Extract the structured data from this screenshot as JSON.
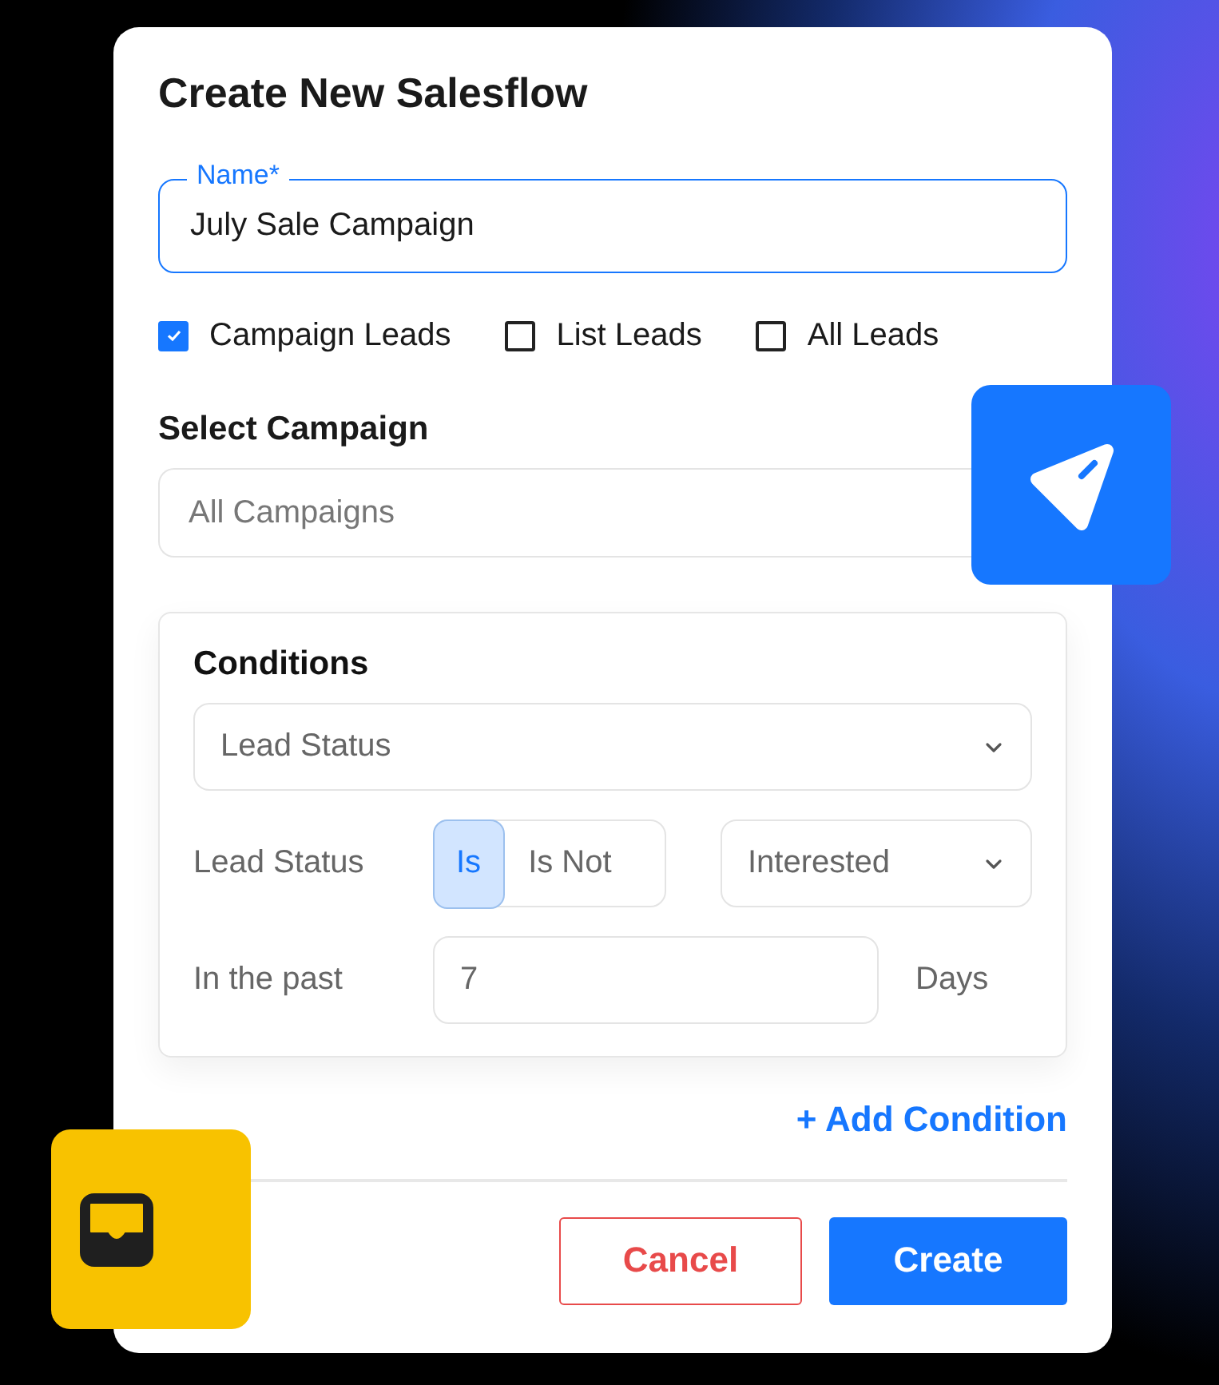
{
  "dialog": {
    "title": "Create New Salesflow",
    "name_field": {
      "label": "Name*",
      "value": "July Sale Campaign"
    },
    "lead_sources": [
      {
        "label": "Campaign Leads",
        "checked": true
      },
      {
        "label": "List Leads",
        "checked": false
      },
      {
        "label": "All Leads",
        "checked": false
      }
    ],
    "campaign": {
      "label": "Select Campaign",
      "placeholder": "All Campaigns"
    },
    "conditions": {
      "title": "Conditions",
      "field_select": "Lead Status",
      "status_row": {
        "label": "Lead Status",
        "operators": [
          {
            "label": "Is",
            "selected": true
          },
          {
            "label": "Is Not",
            "selected": false
          }
        ],
        "value": "Interested"
      },
      "past_row": {
        "label": "In the past",
        "value": "7",
        "unit": "Days"
      }
    },
    "add_condition": "+ Add Condition",
    "buttons": [
      {
        "label": "Cancel",
        "kind": "secondary"
      },
      {
        "label": "Create",
        "kind": "primary"
      }
    ]
  }
}
